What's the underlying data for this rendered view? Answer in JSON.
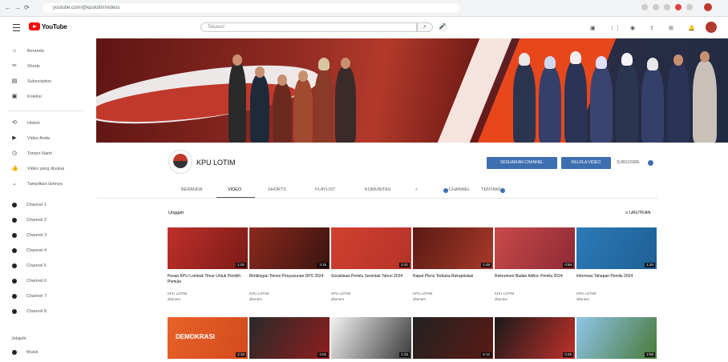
{
  "browser": {
    "url": "youtube.com/@kpulotim/videos"
  },
  "header": {
    "logo_text": "YouTube",
    "search_placeholder": "Telusuri"
  },
  "sidebar": {
    "items": [
      {
        "label": "Beranda",
        "icon": "home-icon",
        "glyph": "⌂"
      },
      {
        "label": "Shorts",
        "icon": "shorts-icon",
        "glyph": "✂"
      },
      {
        "label": "Subscription",
        "icon": "subscriptions-icon",
        "glyph": "▤"
      },
      {
        "label": "Koleksi",
        "icon": "library-icon",
        "glyph": "▣"
      },
      {
        "label": "Histori",
        "icon": "history-icon",
        "glyph": "⟲"
      },
      {
        "label": "Video Anda",
        "icon": "your-videos-icon",
        "glyph": "▶"
      },
      {
        "label": "Tonton Nanti",
        "icon": "watch-later-icon",
        "glyph": "◷"
      },
      {
        "label": "Video yang disukai",
        "icon": "liked-icon",
        "glyph": "👍"
      },
      {
        "label": "Tampilkan lainnya",
        "icon": "chevron-down-icon",
        "glyph": "⌄"
      }
    ],
    "subscriptions": [
      {
        "label": "Channel 1"
      },
      {
        "label": "Channel 2"
      },
      {
        "label": "Channel 3"
      },
      {
        "label": "Channel 4"
      },
      {
        "label": "Channel 5"
      },
      {
        "label": "Channel 6"
      },
      {
        "label": "Channel 7"
      },
      {
        "label": "Channel 8"
      }
    ],
    "explore_title": "Jelajahi",
    "explore": [
      {
        "label": "Musik"
      }
    ]
  },
  "channel": {
    "name": "KPU LOTIM",
    "customize_label": "SESUAIKAN CHANNEL",
    "manage_label": "KELOLA VIDEO",
    "subscribe_text": "SUBSCRIBE"
  },
  "tabs": [
    {
      "label": "BERANDA"
    },
    {
      "label": "VIDEO"
    },
    {
      "label": "SHORTS"
    },
    {
      "label": "PLAYLIST"
    },
    {
      "label": "KOMUNITAS"
    },
    {
      "label": "CHANNEL"
    },
    {
      "label": "TENTANG"
    }
  ],
  "section": {
    "title": "Unggah",
    "sort_label": "URUTKAN"
  },
  "videos_row1": [
    {
      "title": "Pesan KPU Lombok Timur Untuk Pemilih Pemula",
      "meta1": "KPU LOTIM",
      "meta2": "ditonton",
      "duration": "1:02",
      "colors": [
        "#c0302a",
        "#7a1b18"
      ]
    },
    {
      "title": "Bimbingan Teknis Penyusunan DPS 2024",
      "meta1": "KPU LOTIM",
      "meta2": "ditonton",
      "duration": "3:15",
      "colors": [
        "#8c2a1e",
        "#3a1410"
      ]
    },
    {
      "title": "Sosialisasi Pemilu Serentak Tahun 2024",
      "meta1": "KPU LOTIM",
      "meta2": "ditonton",
      "duration": "2:41",
      "colors": [
        "#d04030",
        "#b63328"
      ]
    },
    {
      "title": "Rapat Pleno Terbuka Rekapitulasi",
      "meta1": "KPU LOTIM",
      "meta2": "ditonton",
      "duration": "1:48",
      "colors": [
        "#5a1a14",
        "#a83a2a"
      ]
    },
    {
      "title": "Rekrutmen Badan Adhoc Pemilu 2024",
      "meta1": "KPU LOTIM",
      "meta2": "ditonton",
      "duration": "0:58",
      "colors": [
        "#c84a4a",
        "#8e2a35"
      ]
    },
    {
      "title": "Informasi Tahapan Pemilu 2024",
      "meta1": "KPU LOTIM",
      "meta2": "ditonton",
      "duration": "1:20",
      "colors": [
        "#2b7bb8",
        "#1f5f96"
      ]
    }
  ],
  "videos_row2": [
    {
      "duration": "2:10",
      "label": "DEMOKRASI",
      "colors": [
        "#e8622a",
        "#d34a1c"
      ]
    },
    {
      "duration": "4:02",
      "label": "",
      "colors": [
        "#2a2a2a",
        "#8e1e1e"
      ]
    },
    {
      "duration": "1:33",
      "label": "",
      "colors": [
        "#f2f2f2",
        "#3a3a3a"
      ]
    },
    {
      "duration": "5:12",
      "label": "",
      "colors": [
        "#222",
        "#5a1a14"
      ]
    },
    {
      "duration": "0:45",
      "label": "",
      "colors": [
        "#1b1b1b",
        "#c0302a"
      ]
    },
    {
      "duration": "2:58",
      "label": "",
      "colors": [
        "#8ec5e8",
        "#4a7a3a"
      ]
    }
  ]
}
